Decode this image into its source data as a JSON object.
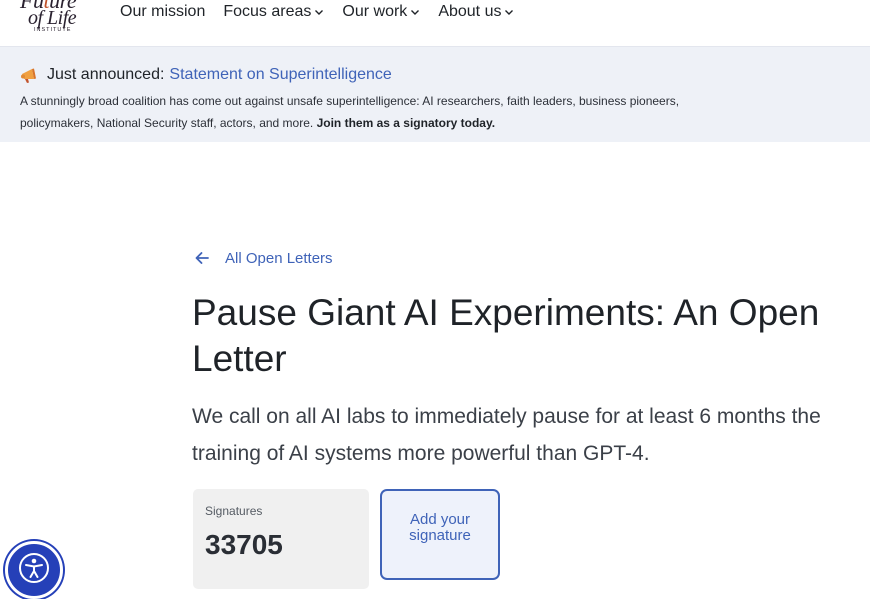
{
  "brand": {
    "logo_line1": "Fu",
    "logo_accent": "t",
    "logo_line1_rest": "ure",
    "logo_line2": "of Life",
    "logo_line3": "INSTITUTE"
  },
  "nav": {
    "items": [
      {
        "label": "Our mission",
        "dropdown": false
      },
      {
        "label": "Focus areas",
        "dropdown": true
      },
      {
        "label": "Our work",
        "dropdown": true
      },
      {
        "label": "About us",
        "dropdown": true
      }
    ]
  },
  "banner": {
    "icon": "megaphone-icon",
    "lead": "Just announced:",
    "link": "Statement on Superintelligence",
    "body": "A stunningly broad coalition has come out against unsafe superintelligence: AI researchers, faith leaders, business pioneers, policymakers, National Security staff, actors, and more.",
    "cta": "Join them as a signatory today."
  },
  "main": {
    "back_label": "All Open Letters",
    "title": "Pause Giant AI Experiments: An Open Letter",
    "subtitle": "We call on all AI labs to immediately pause for at least 6 months the training of AI systems more powerful than GPT-4.",
    "signatures_label": "Signatures",
    "signatures_count": "33705",
    "add_signature_label": "Add your signature"
  },
  "colors": {
    "accent": "#3f63b8",
    "banner_bg": "#eef1f7",
    "a11y_button": "#2540b8"
  }
}
